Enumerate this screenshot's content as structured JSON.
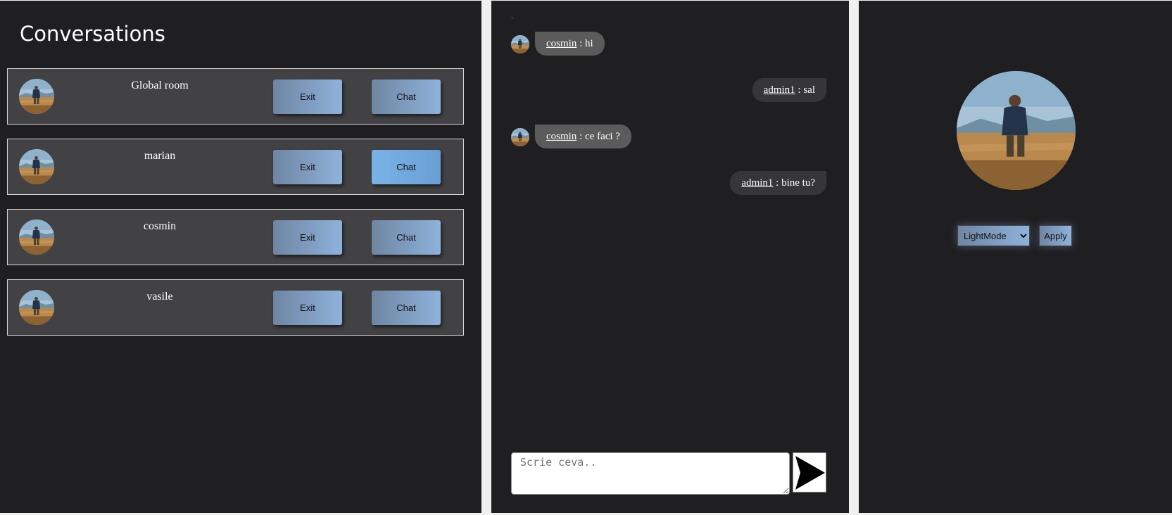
{
  "conversations_panel": {
    "title": "Conversations",
    "items": [
      {
        "name": "Global room",
        "exit_label": "Exit",
        "chat_label": "Chat"
      },
      {
        "name": "marian",
        "exit_label": "Exit",
        "chat_label": "Chat",
        "active": true
      },
      {
        "name": "cosmin",
        "exit_label": "Exit",
        "chat_label": "Chat"
      },
      {
        "name": "vasile",
        "exit_label": "Exit",
        "chat_label": "Chat"
      }
    ]
  },
  "chat_panel": {
    "top_mark": ".",
    "messages": [
      {
        "user": "cosmin",
        "text": " : hi",
        "direction": "incoming"
      },
      {
        "user": "admin1",
        "text": " : sal",
        "direction": "outgoing"
      },
      {
        "user": "cosmin",
        "text": " : ce faci ?",
        "direction": "incoming"
      },
      {
        "user": "admin1",
        "text": " : bine tu?",
        "direction": "outgoing"
      }
    ],
    "input_placeholder": "Scrie ceva..",
    "send_icon": "send-arrow-icon"
  },
  "settings_panel": {
    "theme_options": [
      "LightMode"
    ],
    "theme_selected": "LightMode",
    "apply_label": "Apply"
  },
  "colors": {
    "panel_bg": "#1f1f22",
    "conversation_row_bg": "#424245",
    "button_gradient_start": "#6f86a3",
    "button_gradient_end": "#8eb1db",
    "active_button": "#78b2e6",
    "incoming_bubble": "#5c5b5c",
    "outgoing_bubble": "#363638"
  }
}
